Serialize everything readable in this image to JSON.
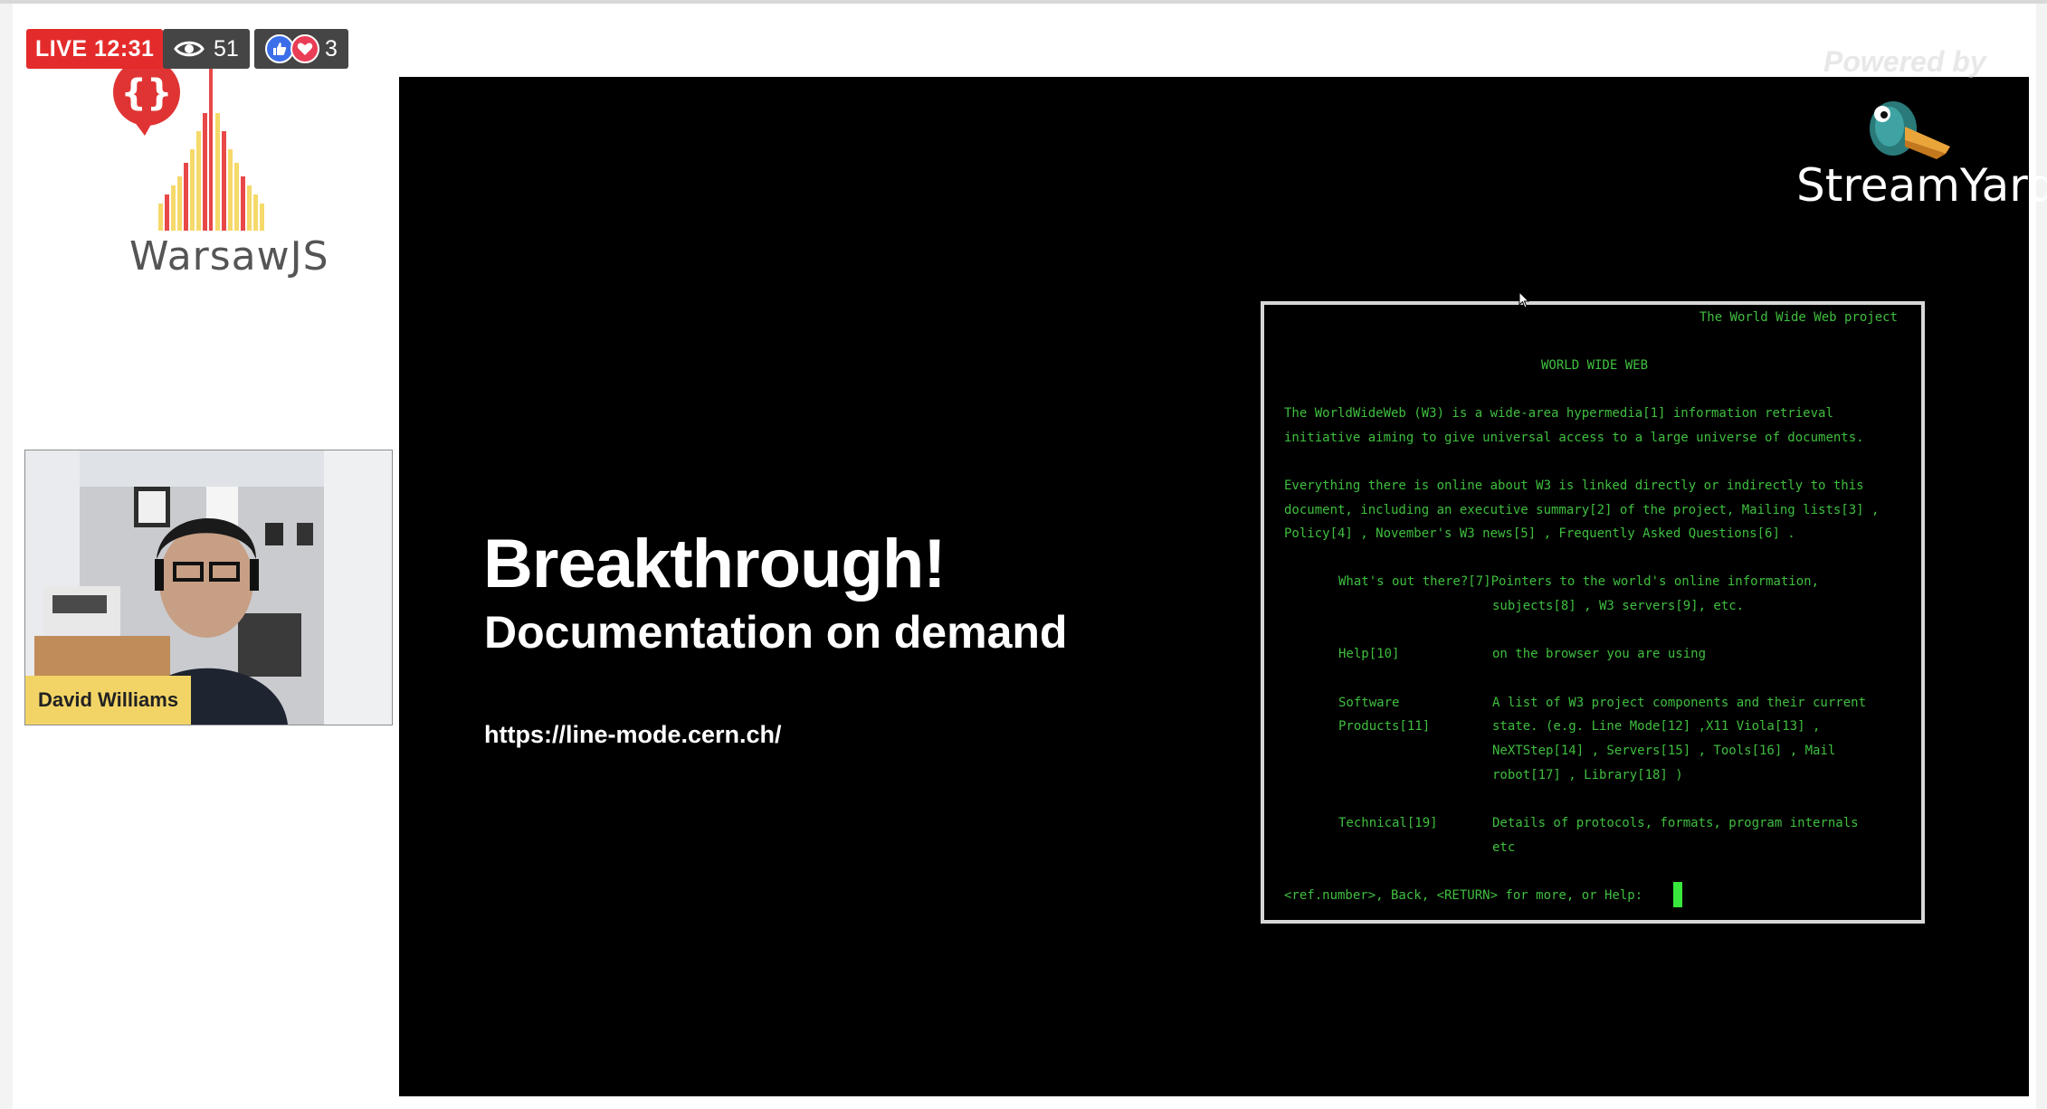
{
  "stream": {
    "live_label": "LIVE 12:31",
    "viewer_count": "51",
    "reaction_count": "3",
    "icons": [
      "eye-icon",
      "thumbs-up-icon",
      "heart-icon"
    ]
  },
  "branding": {
    "logo_text": "WarsawJS",
    "powered_by": "Powered by",
    "streamyard_text": "StreamYard"
  },
  "participant": {
    "name": "David Williams"
  },
  "slide": {
    "title": "Breakthrough!",
    "subtitle": "Documentation on demand",
    "url": "https://line-mode.cern.ch/"
  },
  "terminal": {
    "lines": [
      "The World Wide Web project",
      "WORLD WIDE WEB",
      "The WorldWideWeb (W3) is a wide-area hypermedia[1] information retrieval",
      "initiative aiming to give universal access to a large universe of documents.",
      "Everything there is online about W3 is linked directly or indirectly to this",
      "document, including an executive summary[2] of the project, Mailing lists[3] ,",
      "Policy[4] , November's W3 news[5] , Frequently Asked Questions[6] .",
      "What's out there?[7]Pointers to the world's online information,",
      "subjects[8] , W3 servers[9], etc.",
      "Help[10]",
      "on the browser you are using",
      "Software",
      "Products[11]",
      "A list of W3 project components and their current",
      "state. (e.g. Line Mode[12] ,X11 Viola[13] ,",
      "NeXTStep[14] , Servers[15] , Tools[16] , Mail",
      "robot[17] , Library[18] )",
      "Technical[19]",
      "Details of protocols, formats, program internals",
      "etc",
      "<ref.number>, Back, <RETURN> for more, or Help:"
    ]
  }
}
